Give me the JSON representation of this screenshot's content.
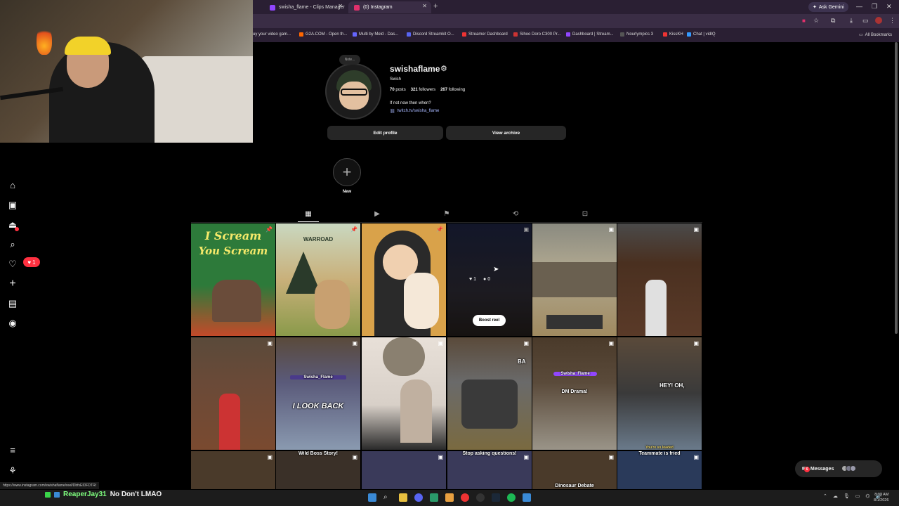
{
  "browser": {
    "tabs": [
      {
        "label": "swisha_flame - Clips Manager",
        "active": false,
        "fav_color": "#9146ff"
      },
      {
        "label": "(0) Instagram",
        "active": true,
        "fav_color": "#e1306c"
      }
    ],
    "ask_gemini": "Ask Gemini",
    "new_tab": "+",
    "bookmarks": [
      {
        "label": "uy your video gam...",
        "color": "#e74"
      },
      {
        "label": "G2A.COM - Open th...",
        "color": "#f60"
      },
      {
        "label": "Multi by Meld - Das...",
        "color": "#66f"
      },
      {
        "label": "Discord Streamkit O...",
        "color": "#5865f2"
      },
      {
        "label": "Streamer Dashboard",
        "color": "#e33"
      },
      {
        "label": "Sihoo Doro C300 Pr...",
        "color": "#c33"
      },
      {
        "label": "Dashboard | Stream...",
        "color": "#9146ff"
      },
      {
        "label": "Nourlympics 3",
        "color": "#333"
      },
      {
        "label": "KissKH",
        "color": "#e33"
      },
      {
        "label": "Chat | vidIQ",
        "color": "#39f"
      }
    ],
    "all_bookmarks": "All Bookmarks",
    "status_url": "https://www.instagram.com/swishaflame/reel/DbfsEIDFDTR/"
  },
  "nav": {
    "notifications_count": "1",
    "filter_badge": "6"
  },
  "profile": {
    "note": "Note...",
    "username": "swishaflame",
    "display_name": "Swish",
    "posts_count": "70",
    "posts_label": "posts",
    "followers_count": "321",
    "followers_label": "followers",
    "following_count": "267",
    "following_label": "following",
    "bio": "If not now then when?",
    "link": "twitch.tv/swisha_flame",
    "edit_profile": "Edit profile",
    "view_archive": "View archive",
    "new_highlight": "New"
  },
  "grid": {
    "captions": {
      "c1_line1": "I Scream",
      "c1_line2": "You Scream",
      "c2": "WARROAD",
      "c8": "Swisha_Flame",
      "c8b": "I LOOK BACK",
      "c11": "Swisha_Flame",
      "c12": "HEY! OH,",
      "c17": "DM Drama!",
      "c18": "You're so loaded",
      "c18b": "Teammate is fried",
      "c20": "Wild Boss Story!",
      "c22": "Stop asking questions!",
      "c23": "Dinosaur Debate",
      "c14": "BA"
    },
    "hover": {
      "likes": "1",
      "comments": "0",
      "boost": "Boost reel"
    }
  },
  "messages_label": "Messages",
  "messages_badge": "6",
  "taskbar": {
    "chat_user": "ReaperJay31",
    "chat_text": "No Don't LMAO",
    "time": "8:13 AM",
    "date": "8/1/2026"
  }
}
